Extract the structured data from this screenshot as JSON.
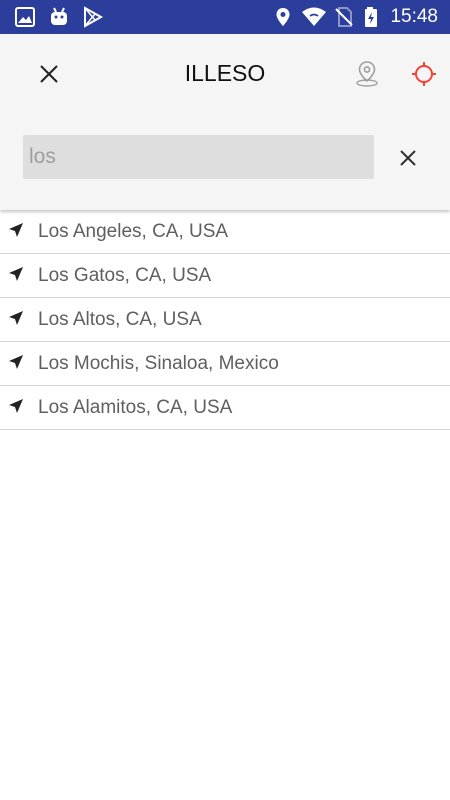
{
  "status_bar": {
    "time": "15:48",
    "left_icons": [
      "image-icon",
      "android-icon",
      "play-store-icon"
    ],
    "right_icons": [
      "location-pin-icon",
      "wifi-icon",
      "no-sim-icon",
      "battery-charging-icon"
    ]
  },
  "app_bar": {
    "title": "ILLESO",
    "left_icon": "close-icon",
    "right_icons": [
      "map-pin-outline-icon",
      "crosshair-icon"
    ]
  },
  "search": {
    "value": "los",
    "clear_icon": "close-icon"
  },
  "results": [
    {
      "label": "Los Angeles, CA, USA"
    },
    {
      "label": "Los Gatos, CA, USA"
    },
    {
      "label": "Los Altos, CA, USA"
    },
    {
      "label": "Los Mochis, Sinaloa, Mexico"
    },
    {
      "label": "Los Alamitos, CA, USA"
    }
  ],
  "colors": {
    "status_bar": "#2c3e9c",
    "accent": "#f44336",
    "text_primary": "#111111",
    "text_secondary": "#5f5f5f"
  }
}
